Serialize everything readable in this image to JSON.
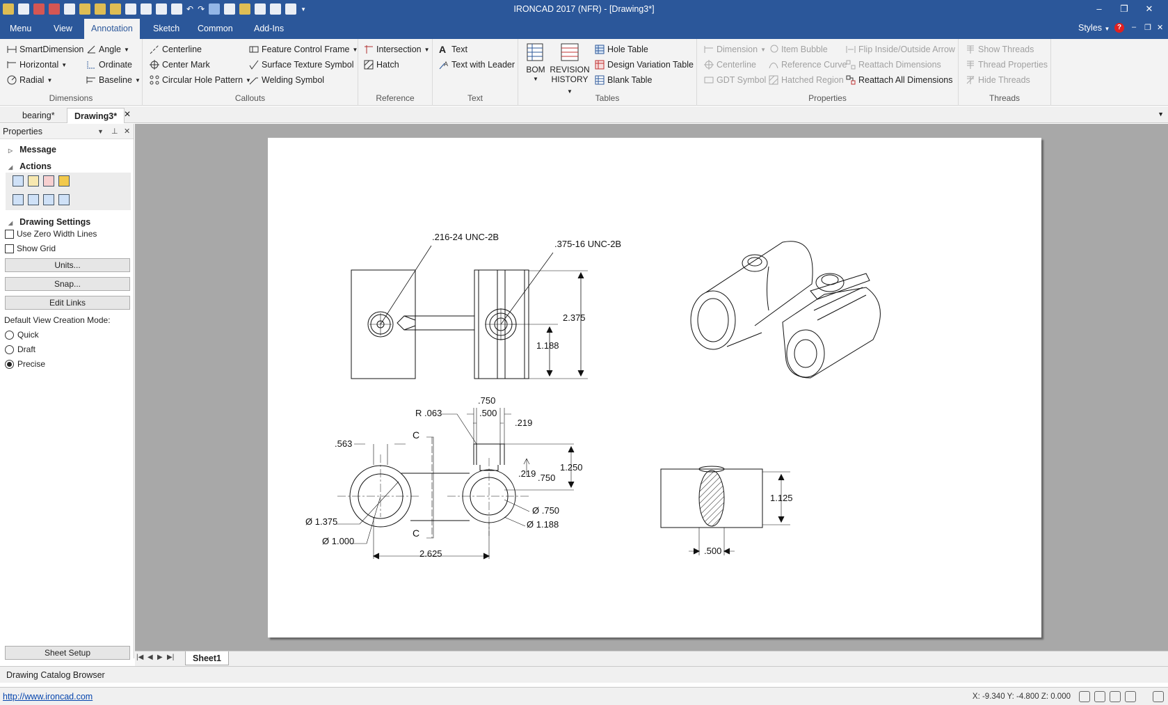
{
  "window": {
    "title": "IRONCAD 2017 (NFR) - [Drawing3*]",
    "controls": [
      "–",
      "❐",
      "✕"
    ]
  },
  "ribbon_tabs": [
    "Menu",
    "View",
    "Annotation",
    "Sketch",
    "Common",
    "Add-Ins"
  ],
  "active_tab": "Annotation",
  "styles_label": "Styles",
  "groups": {
    "dimensions": {
      "title": "Dimensions",
      "items": [
        "SmartDimension",
        "Angle",
        "Horizontal",
        "Ordinate",
        "Radial",
        "Baseline"
      ]
    },
    "callouts": {
      "title": "Callouts",
      "items": [
        "Centerline",
        "Feature Control Frame",
        "Center Mark",
        "Surface Texture Symbol",
        "Circular Hole Pattern",
        "Welding Symbol"
      ]
    },
    "reference": {
      "title": "Reference",
      "items": [
        "Intersection",
        "Hatch"
      ]
    },
    "text": {
      "title": "Text",
      "items": [
        "Text",
        "Text with Leader"
      ]
    },
    "tables": {
      "title": "Tables",
      "bom": "BOM",
      "revision": [
        "REVISION",
        "HISTORY"
      ],
      "items": [
        "Hole Table",
        "Design Variation Table",
        "Blank Table"
      ]
    },
    "properties": {
      "title": "Properties",
      "items": [
        "Dimension",
        "Item Bubble",
        "Flip Inside/Outside Arrow",
        "Centerline",
        "Reference Curve",
        "Reattach Dimensions",
        "GDT Symbol",
        "Hatched Region",
        "Reattach All Dimensions"
      ]
    },
    "threads": {
      "title": "Threads",
      "items": [
        "Show Threads",
        "Thread Properties",
        "Hide Threads"
      ]
    }
  },
  "doc_tabs": [
    "bearing*",
    "Drawing3*"
  ],
  "active_doc": "Drawing3*",
  "properties_panel": {
    "title": "Properties",
    "message": "Message",
    "actions": "Actions",
    "drawing_settings": "Drawing Settings",
    "use_zero_width": "Use Zero Width Lines",
    "use_zero_width_checked": false,
    "show_grid": "Show Grid",
    "show_grid_checked": false,
    "buttons": [
      "Units...",
      "Snap...",
      "Edit Links"
    ],
    "view_mode_label": "Default View Creation Mode:",
    "modes": [
      "Quick",
      "Draft",
      "Precise"
    ],
    "selected_mode": "Precise",
    "sheet_setup": "Sheet Setup"
  },
  "drawing": {
    "thread1": ".216-24 UNC-2B",
    "thread2": ".375-16 UNC-2B",
    "d_2375": "2.375",
    "d_1188": "1.188",
    "d_750a": ".750",
    "d_500": ".500",
    "d_219a": ".219",
    "d_r063": "R .063",
    "d_563": ".563",
    "d_c1": "C",
    "d_c2": "C",
    "d_1250": "1.250",
    "d_219b": ".219",
    "d_750b": ".750",
    "d_dia1375": "Ø 1.375",
    "d_dia1000": "Ø 1.000",
    "d_dia750": "Ø .750",
    "d_dia1188": "Ø 1.188",
    "d_2625": "2.625",
    "d_1125": "1.125",
    "d_500b": ".500"
  },
  "sheet_tab": "Sheet1",
  "catalog_label": "Drawing Catalog Browser",
  "status": {
    "link": "http://www.ironcad.com",
    "coords": "X: -9.340 Y: -4.800 Z: 0.000"
  },
  "colors": {
    "title_bar": "#2b579a",
    "ribbon": "#f3f3f3",
    "canvas": "#a8a8a8"
  }
}
